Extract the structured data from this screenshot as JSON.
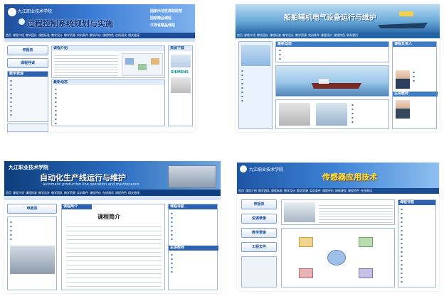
{
  "screens": [
    {
      "school": "九江职业技术学院",
      "title": "过程控制系统规划与实施",
      "slogans": [
        "国家示范性高职院校",
        "国家精品课程",
        "江西省精品课程"
      ],
      "nav": [
        "首页",
        "课程介绍",
        "教学团队",
        "课程标准",
        "教学设计",
        "教学资源",
        "实训条件",
        "教学评价",
        "课程特色",
        "在线测试",
        "相关链接"
      ],
      "apply_label": "申报表",
      "guide_label": "课程导读",
      "sidebar_title": "教学资源",
      "intro_title": "课程介绍",
      "news_title": "最新动态",
      "resource_title": "资源下载",
      "brand": "SIEMENS"
    },
    {
      "title": "船舶辅机电气设备运行与维护",
      "nav": [
        "首页",
        "课程介绍",
        "教学团队",
        "课程标准",
        "教学设计",
        "教学资源",
        "实训条件",
        "课程评价",
        "课程特色",
        "联系我们"
      ],
      "news_title": "最新动态",
      "team_title": "课程负责人",
      "teacher_title": "主讲教师"
    },
    {
      "school": "九江职业技术学院",
      "title": "自动化生产线运行与维护",
      "subtitle": "Automatic production line operation and maintenance",
      "nav": [
        "首页",
        "课程介绍",
        "课程标准",
        "教学设计",
        "教学团队",
        "教学资源",
        "实训条件",
        "课程评价",
        "在线测试",
        "课程特色",
        "相关链接"
      ],
      "apply_label": "申报表",
      "intro_title": "课程简介",
      "content_heading": "课程简介",
      "right_title": "课程导航",
      "teacher_title": "主讲教师"
    },
    {
      "school": "九江职业技术学院",
      "title": "传感器应用技术",
      "nav": [
        "首页",
        "课程介绍",
        "教学团队",
        "课程标准",
        "教学设计",
        "教学资源",
        "实训条件",
        "课程评价",
        "网络课程",
        "课程特色",
        "在线测试"
      ],
      "buttons": [
        "申报表",
        "说课录像",
        "教学录像",
        "工程文件"
      ],
      "right_title": "课程导航"
    }
  ]
}
